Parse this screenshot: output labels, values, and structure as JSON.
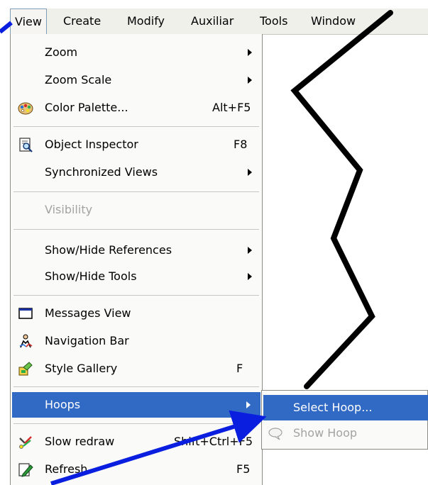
{
  "menubar": {
    "items": [
      {
        "label": "View",
        "active": true
      },
      {
        "label": "Create"
      },
      {
        "label": "Modify"
      },
      {
        "label": "Auxiliar"
      },
      {
        "label": "Tools"
      },
      {
        "label": "Window"
      }
    ]
  },
  "view_menu": {
    "items": [
      {
        "label": "Zoom",
        "submenu": true
      },
      {
        "label": "Zoom Scale",
        "submenu": true
      },
      {
        "label": "Color Palette...",
        "shortcut": "Alt+F5",
        "icon": "palette-icon"
      },
      {
        "label": "Object Inspector",
        "shortcut": "F8",
        "icon": "inspector-icon"
      },
      {
        "label": "Synchronized Views",
        "submenu": true
      },
      {
        "label": "Visibility",
        "disabled": true
      },
      {
        "label": "Show/Hide References",
        "submenu": true
      },
      {
        "label": "Show/Hide Tools",
        "submenu": true
      },
      {
        "label": "Messages View",
        "icon": "window-icon"
      },
      {
        "label": "Navigation Bar",
        "icon": "navigation-icon"
      },
      {
        "label": "Style Gallery",
        "shortcut": "F",
        "icon": "style-gallery-icon"
      },
      {
        "label": "Hoops",
        "submenu": true,
        "highlighted": true
      },
      {
        "label": "Slow redraw",
        "shortcut": "Shift+Ctrl+F5",
        "icon": "slow-redraw-icon"
      },
      {
        "label": "Refresh",
        "shortcut": "F5",
        "icon": "refresh-icon"
      }
    ]
  },
  "hoops_submenu": {
    "items": [
      {
        "label": "Select Hoop...",
        "highlighted": true
      },
      {
        "label": "Show Hoop",
        "disabled": true,
        "icon": "speech-bubble-icon"
      }
    ]
  },
  "colors": {
    "highlight": "#316ac5",
    "arrow": "#0a1ee0",
    "zigzag": "#000000"
  }
}
